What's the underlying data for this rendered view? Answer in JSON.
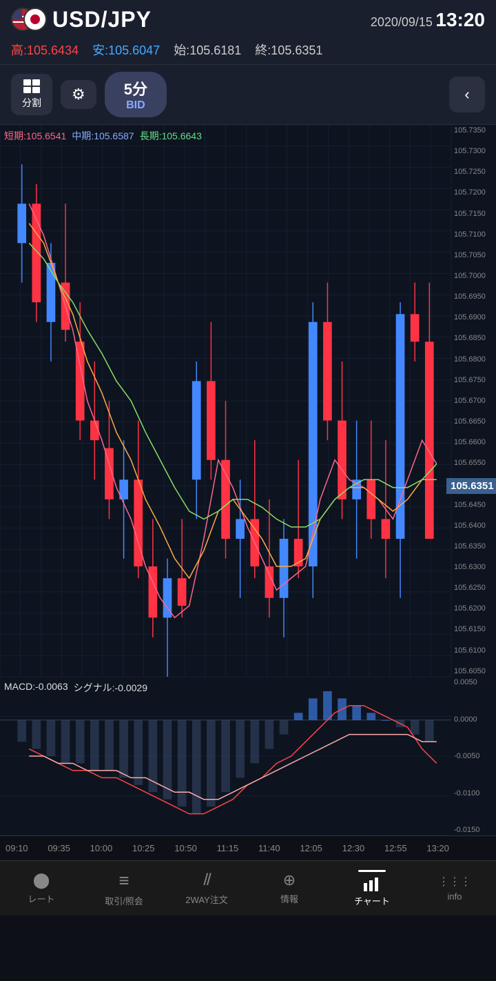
{
  "header": {
    "pair": "USD/JPY",
    "date": "2020/09/15",
    "time": "13:20",
    "flags": {
      "base": "USD",
      "quote": "JPY"
    }
  },
  "ohlc": {
    "high_label": "高:",
    "high_value": "105.6434",
    "low_label": "安:",
    "low_value": "105.6047",
    "open_label": "始:",
    "open_value": "105.6181",
    "close_label": "終:",
    "close_value": "105.6351"
  },
  "toolbar": {
    "split_label": "分割",
    "timeframe": "5分",
    "bid_label": "BID",
    "back_icon": "‹"
  },
  "ma_labels": {
    "short_label": "短期:",
    "short_value": "105.6541",
    "mid_label": "中期:",
    "mid_value": "105.6587",
    "long_label": "長期:",
    "long_value": "105.6643"
  },
  "current_price": "105.6351",
  "macd_labels": {
    "macd_label": "MACD:",
    "macd_value": "-0.0063",
    "signal_label": "シグナル:",
    "signal_value": "-0.0029"
  },
  "price_axis": {
    "values": [
      "105.7350",
      "105.7300",
      "105.7250",
      "105.7200",
      "105.7150",
      "105.7100",
      "105.7050",
      "105.7000",
      "105.6950",
      "105.6900",
      "105.6850",
      "105.6800",
      "105.6750",
      "105.6700",
      "105.6650",
      "105.6600",
      "105.6550",
      "105.6500",
      "105.6450",
      "105.6400",
      "105.6350",
      "105.6300",
      "105.6250",
      "105.6200",
      "105.6150",
      "105.6100",
      "105.6050"
    ]
  },
  "macd_axis": {
    "values": [
      "0.0050",
      "0.0000",
      "-0.0050",
      "-0.0100",
      "-0.0150"
    ]
  },
  "time_axis": {
    "labels": [
      "09:10",
      "09:35",
      "10:00",
      "10:25",
      "10:50",
      "11:15",
      "11:40",
      "12:05",
      "12:30",
      "12:55",
      "13:20"
    ]
  },
  "bottom_nav": {
    "items": [
      {
        "label": "レート",
        "icon": "●",
        "active": false
      },
      {
        "label": "取引/照会",
        "icon": "≡",
        "active": false
      },
      {
        "label": "2WAY注文",
        "icon": "//",
        "active": false
      },
      {
        "label": "情報",
        "icon": "⊕",
        "active": false
      },
      {
        "label": "チャート",
        "icon": "chart",
        "active": true
      },
      {
        "label": "info",
        "icon": "⋮⋮⋮",
        "active": false
      }
    ]
  }
}
